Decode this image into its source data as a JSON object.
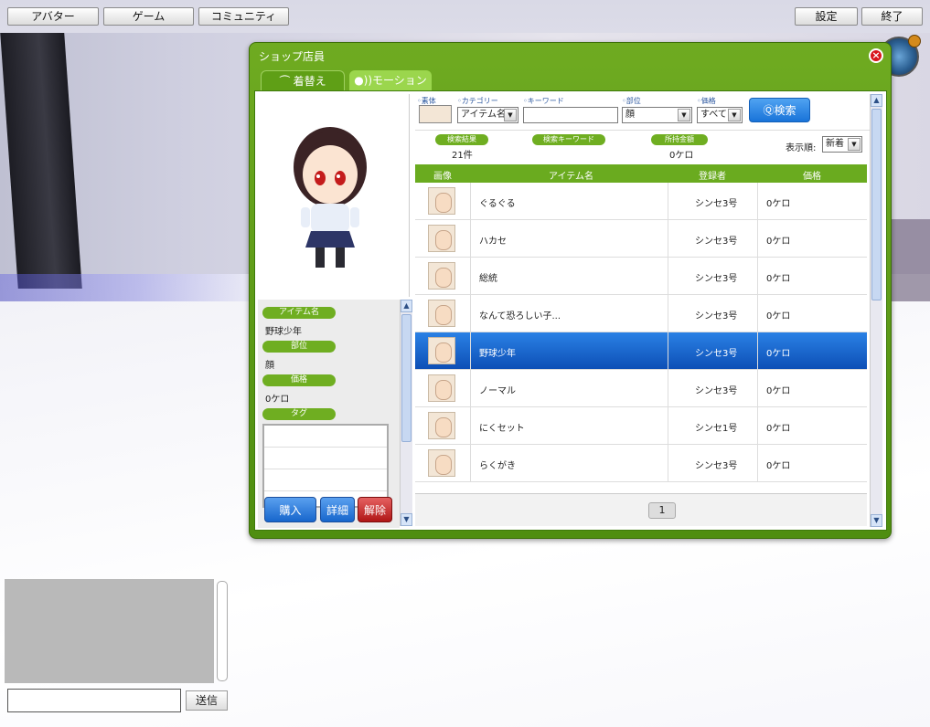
{
  "top_bar": {
    "avatar": "アバター",
    "game": "ゲーム",
    "community": "コミュニティ",
    "settings": "設定",
    "exit": "終了"
  },
  "window": {
    "title": "ショップ店員",
    "close_icon": "close-icon",
    "tabs": [
      {
        "label": "着替え",
        "icon": "hanger-icon"
      },
      {
        "label": "●))モーション",
        "icon": "motion-icon"
      }
    ]
  },
  "filters": {
    "body_label": "素体",
    "category_label": "カテゴリー",
    "category_value": "アイテム名",
    "keyword_label": "キーワード",
    "keyword_value": "",
    "part_label": "部位",
    "part_value": "顔",
    "price_label": "価格",
    "price_value": "すべて",
    "search_button": "検索"
  },
  "summary": {
    "result_label": "検索結果",
    "result_value": "21件",
    "keyword_label": "検索キーワード",
    "keyword_value": "",
    "balance_label": "所持金額",
    "balance_value": "0ケロ",
    "sort_label": "表示順:",
    "sort_value": "新着"
  },
  "table": {
    "headers": [
      "画像",
      "アイテム名",
      "登録者",
      "価格"
    ],
    "rows": [
      {
        "name": "ぐるぐる",
        "registrant": "シンセ3号",
        "price": "0ケロ"
      },
      {
        "name": "ハカセ",
        "registrant": "シンセ3号",
        "price": "0ケロ"
      },
      {
        "name": "総統",
        "registrant": "シンセ3号",
        "price": "0ケロ"
      },
      {
        "name": "なんて恐ろしい子...",
        "registrant": "シンセ3号",
        "price": "0ケロ"
      },
      {
        "name": "野球少年",
        "registrant": "シンセ3号",
        "price": "0ケロ"
      },
      {
        "name": "ノーマル",
        "registrant": "シンセ3号",
        "price": "0ケロ"
      },
      {
        "name": "にくセット",
        "registrant": "シンセ1号",
        "price": "0ケロ"
      },
      {
        "name": "らくがき",
        "registrant": "シンセ3号",
        "price": "0ケロ"
      }
    ],
    "selected_index": 4
  },
  "pager": {
    "current": "1"
  },
  "detail": {
    "item_name_label": "アイテム名",
    "item_name_value": "野球少年",
    "part_label": "部位",
    "part_value": "顔",
    "price_label": "価格",
    "price_value": "0ケロ",
    "tag_label": "タグ",
    "buy_button": "購入",
    "detail_button": "詳細",
    "remove_button": "解除"
  },
  "chat": {
    "send_button": "送信",
    "input_value": ""
  }
}
